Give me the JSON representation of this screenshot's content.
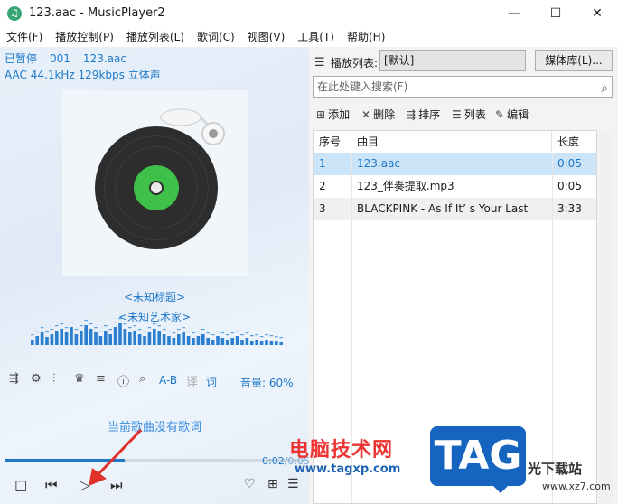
{
  "window": {
    "title": "123.aac - MusicPlayer2",
    "app_icon": "music-note-icon",
    "minimize": "—",
    "maximize": "☐",
    "close": "✕"
  },
  "menu": [
    "文件(F)",
    "播放控制(P)",
    "播放列表(L)",
    "歌词(C)",
    "视图(V)",
    "工具(T)",
    "帮助(H)"
  ],
  "player": {
    "state": "已暂停",
    "track_no": "001",
    "file": "123.aac",
    "format": "AAC 44.1kHz 129kbps 立体声",
    "title": "<未知标题>",
    "artist": "<未知艺术家>",
    "toolbar": {
      "ab": "A-B",
      "lyric": "词",
      "volume": "音量: 60%"
    },
    "no_lyric": "当前歌曲没有歌词",
    "time_current": "0:02",
    "time_total": "/0:05",
    "progress": 0.4
  },
  "playlist": {
    "label": "播放列表:",
    "name": "[默认]",
    "media_lib": "媒体库(L)...",
    "search_placeholder": "在此处键入搜索(F)",
    "tools": [
      "添加",
      "删除",
      "排序",
      "列表",
      "编辑"
    ],
    "columns": [
      "序号",
      "曲目",
      "长度"
    ],
    "rows": [
      {
        "no": "1",
        "track": "123.aac",
        "len": "0:05"
      },
      {
        "no": "2",
        "track": "123_伴奏提取.mp3",
        "len": "0:05"
      },
      {
        "no": "3",
        "track": "BLACKPINK - As If It’ s Your Last",
        "len": "3:33"
      }
    ]
  },
  "watermark": {
    "site_cn": "电脑技术网",
    "site_url": "www.tagxp.com",
    "tag": "TAG",
    "dl_cn": "光下载站",
    "dl_url": "www.xz7.com"
  },
  "colors": {
    "accent": "#1e78c8",
    "selected_row": "#cce4f7",
    "disc_label": "#3ec04b"
  }
}
